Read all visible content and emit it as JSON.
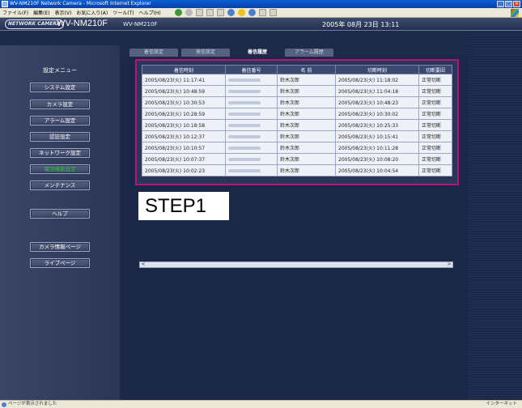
{
  "window": {
    "title": "WV-NM210F Network Camera - Microsoft Internet Explorer"
  },
  "menubar": {
    "items": [
      "ファイル(F)",
      "編集(E)",
      "表示(V)",
      "お気に入り(A)",
      "ツール(T)",
      "ヘルプ(H)"
    ]
  },
  "header": {
    "logo": "NETWORK CAMERA",
    "model_big": "WV-NM210F",
    "model_small": "WV-NM210F",
    "datetime": "2005年 08月 23日 13:11"
  },
  "sidebar": {
    "title": "設定メニュー",
    "items": [
      {
        "label": "システム設定"
      },
      {
        "label": "カメラ設定"
      },
      {
        "label": "アラーム設定"
      },
      {
        "label": "認証設定"
      },
      {
        "label": "ネットワーク設定"
      },
      {
        "label": "電話機能設定"
      },
      {
        "label": "メンテナンス"
      },
      {
        "label": "ヘルプ"
      },
      {
        "label": "カメラ情報ページ"
      },
      {
        "label": "ライブページ"
      }
    ]
  },
  "tabs": [
    {
      "label": "着信設定"
    },
    {
      "label": "発信設定"
    },
    {
      "label": "着信履歴"
    },
    {
      "label": "アラーム履歴"
    }
  ],
  "table": {
    "headers": [
      "着信時刻",
      "着信番号",
      "名 前",
      "切断時刻",
      "切断要因"
    ],
    "rows": [
      [
        "2005/08/23(火) 11:17:41",
        "",
        "鈴木次郎",
        "2005/08/23(火) 11:18:02",
        "正常切断"
      ],
      [
        "2005/08/23(火) 10:48:59",
        "",
        "鈴木次郎",
        "2005/08/23(火) 11:04:18",
        "正常切断"
      ],
      [
        "2005/08/23(火) 10:30:53",
        "",
        "鈴木次郎",
        "2005/08/23(火) 10:48:23",
        "正常切断"
      ],
      [
        "2005/08/23(火) 10:28:59",
        "",
        "鈴木次郎",
        "2005/08/23(火) 10:30:02",
        "正常切断"
      ],
      [
        "2005/08/23(火) 10:18:58",
        "",
        "鈴木次郎",
        "2005/08/23(火) 10:25:33",
        "正常切断"
      ],
      [
        "2005/08/23(火) 10:12:37",
        "",
        "鈴木次郎",
        "2005/08/23(火) 10:15:41",
        "正常切断"
      ],
      [
        "2005/08/23(火) 10:10:57",
        "",
        "鈴木次郎",
        "2005/08/23(火) 10:11:28",
        "正常切断"
      ],
      [
        "2005/08/23(火) 10:07:37",
        "",
        "鈴木次郎",
        "2005/08/23(火) 10:08:20",
        "正常切断"
      ],
      [
        "2005/08/23(火) 10:02:23",
        "",
        "鈴木次郎",
        "2005/08/23(火) 10:04:54",
        "正常切断"
      ]
    ]
  },
  "step_label": "STEP1",
  "scroll": {
    "left_arrow": "<",
    "right_arrow": ">"
  },
  "statusbar": {
    "text": "ページが表示されました",
    "zone": "インターネット"
  },
  "colors": {
    "highlight_frame": "#b5157a",
    "active_menu": "#2fbf3a"
  }
}
